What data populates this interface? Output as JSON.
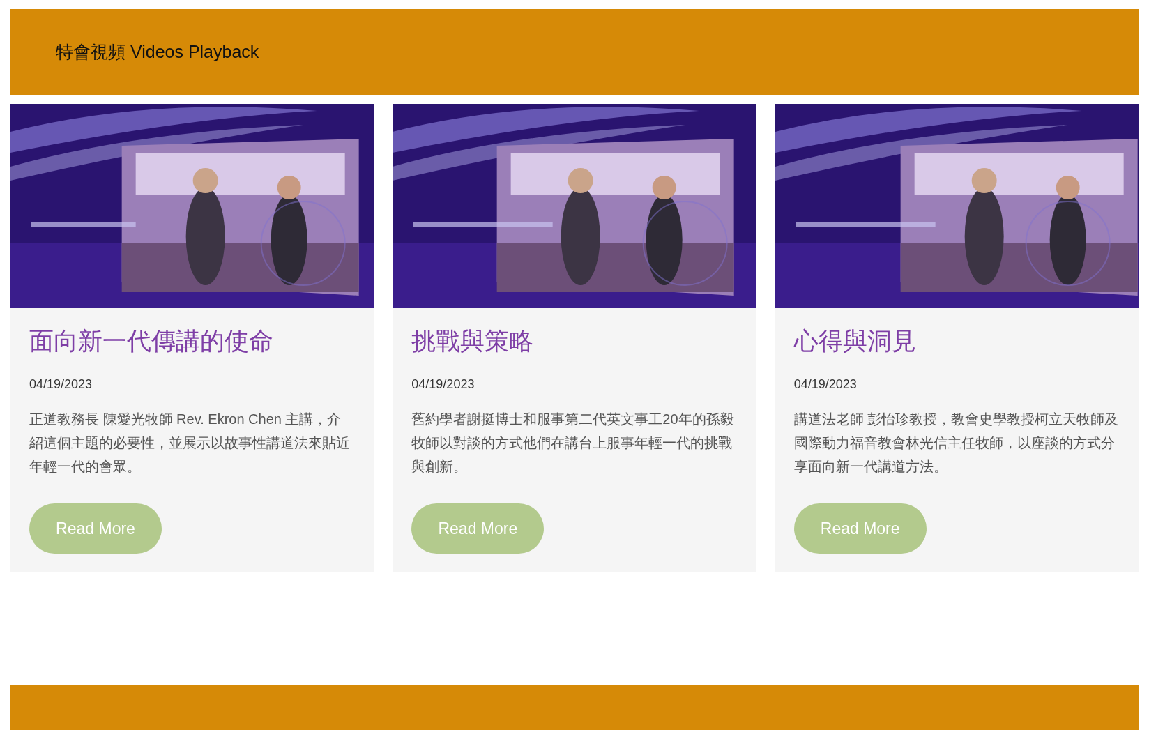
{
  "header": {
    "title": "特會視頻 Videos Playback"
  },
  "cards": [
    {
      "title": "面向新一代傳講的使命",
      "date": "04/19/2023",
      "body": "正道教務長 陳愛光牧師 Rev. Ekron Chen 主講，介紹這個主題的必要性，並展示以故事性講道法來貼近年輕一代的會眾。",
      "button": "Read More"
    },
    {
      "title": "挑戰與策略",
      "date": "04/19/2023",
      "body": "舊約學者謝挺博士和服事第二代英文事工20年的孫毅牧師以對談的方式他們在講台上服事年輕一代的挑戰與創新。",
      "button": "Read More"
    },
    {
      "title": "心得與洞見",
      "date": "04/19/2023",
      "body": "講道法老師 彭怡珍教授，教會史學教授柯立天牧師及國際動力福音教會林光信主任牧師，以座談的方式分享面向新一代講道方法。",
      "button": "Read More"
    }
  ]
}
